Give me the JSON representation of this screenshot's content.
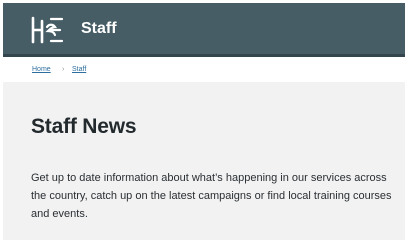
{
  "header": {
    "logo_icon": "hse-logo-icon",
    "title": "Staff"
  },
  "breadcrumb": {
    "items": [
      "Home",
      "Staff"
    ],
    "separator": "›"
  },
  "main": {
    "title": "Staff News",
    "intro": "Get up to date information about what’s happening in our services across the country, catch up on the latest campaigns or find local training courses and events."
  },
  "colors": {
    "header_bg": "#475d66",
    "page_bg": "#f2f2f2",
    "link": "#2d6f9e",
    "text": "#232a2e"
  }
}
